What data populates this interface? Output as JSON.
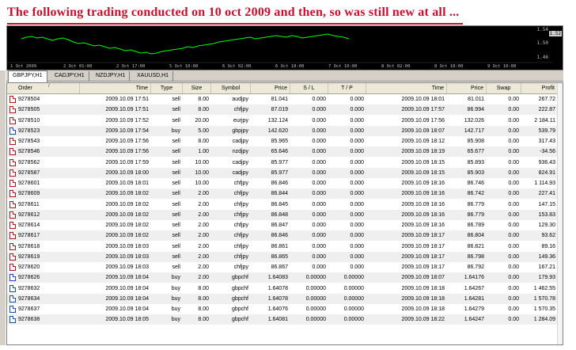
{
  "headline": "The following trading conducted on 10 oct 2009 and then, so was still new at all ...",
  "chart": {
    "price_labels": [
      "1.54",
      "1.50",
      "1.46"
    ],
    "current_price": "1.52",
    "time_labels": [
      "1 Oct 2009",
      "2 Oct 01:00",
      "2 Oct 17:00",
      "5 Oct 10:00",
      "6 Oct 02:00",
      "6 Oct 18:00",
      "7 Oct 10:00",
      "8 Oct 02:00",
      "8 Oct 18:00",
      "9 Oct 10:00"
    ],
    "line_color": "#00ff00"
  },
  "tabs": [
    "GBPJPY,H1",
    "CADJPY,H1",
    "NZDJPY,H1",
    "XAUUSD,H1"
  ],
  "columns": [
    "Order",
    "Time",
    "Type",
    "Size",
    "Symbol",
    "Price",
    "S / L",
    "T / P",
    "Time",
    "Price",
    "Swap",
    "Profit"
  ],
  "sort_indicator": "/",
  "rows": [
    {
      "order": "9278504",
      "open_time": "2009.10.09 17:51",
      "type": "sell",
      "size": "8.00",
      "symbol": "audjpy",
      "price": "81.041",
      "sl": "0.000",
      "tp": "0.000",
      "close_time": "2009.10.09 18:01",
      "close_price": "81.011",
      "swap": "0.00",
      "profit": "267.72"
    },
    {
      "order": "9278505",
      "open_time": "2009.10.09 17:51",
      "type": "sell",
      "size": "8.00",
      "symbol": "chfjpy",
      "price": "87.019",
      "sl": "0.000",
      "tp": "0.000",
      "close_time": "2009.10.09 17:57",
      "close_price": "86.994",
      "swap": "0.00",
      "profit": "222.87"
    },
    {
      "order": "9278510",
      "open_time": "2009.10.09 17:52",
      "type": "sell",
      "size": "20.00",
      "symbol": "eurjpy",
      "price": "132.124",
      "sl": "0.000",
      "tp": "0.000",
      "close_time": "2009.10.09 17:56",
      "close_price": "132.026",
      "swap": "0.00",
      "profit": "2 184.11"
    },
    {
      "order": "9278523",
      "open_time": "2009.10.09 17:54",
      "type": "buy",
      "size": "5.00",
      "symbol": "gbpjpy",
      "price": "142.620",
      "sl": "0.000",
      "tp": "0.000",
      "close_time": "2009.10.09 18:07",
      "close_price": "142.717",
      "swap": "0.00",
      "profit": "539.79"
    },
    {
      "order": "9278543",
      "open_time": "2009.10.09 17:56",
      "type": "sell",
      "size": "8.00",
      "symbol": "cadjpy",
      "price": "85.965",
      "sl": "0.000",
      "tp": "0.000",
      "close_time": "2009.10.09 18:12",
      "close_price": "85.908",
      "swap": "0.00",
      "profit": "317.43"
    },
    {
      "order": "9278546",
      "open_time": "2009.10.09 17:56",
      "type": "sell",
      "size": "1.00",
      "symbol": "nzdjpy",
      "price": "65.646",
      "sl": "0.000",
      "tp": "0.000",
      "close_time": "2009.10.09 18:19",
      "close_price": "65.677",
      "swap": "0.00",
      "profit": "-34.56"
    },
    {
      "order": "9278562",
      "open_time": "2009.10.09 17:59",
      "type": "sell",
      "size": "10.00",
      "symbol": "cadjpy",
      "price": "85.977",
      "sl": "0.000",
      "tp": "0.000",
      "close_time": "2009.10.09 18:15",
      "close_price": "85.893",
      "swap": "0.00",
      "profit": "936.43"
    },
    {
      "order": "9278587",
      "open_time": "2009.10.09 18:00",
      "type": "sell",
      "size": "10.00",
      "symbol": "cadjpy",
      "price": "85.977",
      "sl": "0.000",
      "tp": "0.000",
      "close_time": "2009.10.09 18:15",
      "close_price": "85.903",
      "swap": "0.00",
      "profit": "824.91"
    },
    {
      "order": "9278601",
      "open_time": "2009.10.09 18:01",
      "type": "sell",
      "size": "10.00",
      "symbol": "chfjpy",
      "price": "86.846",
      "sl": "0.000",
      "tp": "0.000",
      "close_time": "2009.10.09 18:16",
      "close_price": "86.746",
      "swap": "0.00",
      "profit": "1 114.93"
    },
    {
      "order": "9278609",
      "open_time": "2009.10.09 18:02",
      "type": "sell",
      "size": "2.00",
      "symbol": "chfjpy",
      "price": "86.844",
      "sl": "0.000",
      "tp": "0.000",
      "close_time": "2009.10.09 18:16",
      "close_price": "86.742",
      "swap": "0.00",
      "profit": "227.41"
    },
    {
      "order": "9278611",
      "open_time": "2009.10.09 18:02",
      "type": "sell",
      "size": "2.00",
      "symbol": "chfjpy",
      "price": "86.845",
      "sl": "0.000",
      "tp": "0.000",
      "close_time": "2009.10.09 18:16",
      "close_price": "86.779",
      "swap": "0.00",
      "profit": "147.15"
    },
    {
      "order": "9278612",
      "open_time": "2009.10.09 18:02",
      "type": "sell",
      "size": "2.00",
      "symbol": "chfjpy",
      "price": "86.848",
      "sl": "0.000",
      "tp": "0.000",
      "close_time": "2009.10.09 18:16",
      "close_price": "86.779",
      "swap": "0.00",
      "profit": "153.83"
    },
    {
      "order": "9278614",
      "open_time": "2009.10.09 18:02",
      "type": "sell",
      "size": "2.00",
      "symbol": "chfjpy",
      "price": "86.847",
      "sl": "0.000",
      "tp": "0.000",
      "close_time": "2009.10.09 18:16",
      "close_price": "86.789",
      "swap": "0.00",
      "profit": "129.30"
    },
    {
      "order": "9278617",
      "open_time": "2009.10.09 18:02",
      "type": "sell",
      "size": "2.00",
      "symbol": "chfjpy",
      "price": "86.846",
      "sl": "0.000",
      "tp": "0.000",
      "close_time": "2009.10.09 18:17",
      "close_price": "86.804",
      "swap": "0.00",
      "profit": "93.62"
    },
    {
      "order": "9278618",
      "open_time": "2009.10.09 18:03",
      "type": "sell",
      "size": "2.00",
      "symbol": "chfjpy",
      "price": "86.861",
      "sl": "0.000",
      "tp": "0.000",
      "close_time": "2009.10.09 18:17",
      "close_price": "86.821",
      "swap": "0.00",
      "profit": "89.16"
    },
    {
      "order": "9278619",
      "open_time": "2009.10.09 18:03",
      "type": "sell",
      "size": "2.00",
      "symbol": "chfjpy",
      "price": "86.865",
      "sl": "0.000",
      "tp": "0.000",
      "close_time": "2009.10.09 18:17",
      "close_price": "86.798",
      "swap": "0.00",
      "profit": "149.36"
    },
    {
      "order": "9278620",
      "open_time": "2009.10.09 18:03",
      "type": "sell",
      "size": "2.00",
      "symbol": "chfjpy",
      "price": "86.867",
      "sl": "0.000",
      "tp": "0.000",
      "close_time": "2009.10.09 18:17",
      "close_price": "86.792",
      "swap": "0.00",
      "profit": "167.21"
    },
    {
      "order": "9278626",
      "open_time": "2009.10.09 18:04",
      "type": "buy",
      "size": "2.00",
      "symbol": "gbpchf",
      "price": "1.64083",
      "sl": "0.00000",
      "tp": "0.00000",
      "close_time": "2009.10.09 18:07",
      "close_price": "1.64176",
      "swap": "0.00",
      "profit": "179.93"
    },
    {
      "order": "9278632",
      "open_time": "2009.10.09 18:04",
      "type": "buy",
      "size": "8.00",
      "symbol": "gbpchf",
      "price": "1.64078",
      "sl": "0.00000",
      "tp": "0.00000",
      "close_time": "2009.10.09 18:18",
      "close_price": "1.64267",
      "swap": "0.00",
      "profit": "1 462.55"
    },
    {
      "order": "9278634",
      "open_time": "2009.10.09 18:04",
      "type": "buy",
      "size": "8.00",
      "symbol": "gbpchf",
      "price": "1.64078",
      "sl": "0.00000",
      "tp": "0.00000",
      "close_time": "2009.10.09 18:18",
      "close_price": "1.64281",
      "swap": "0.00",
      "profit": "1 570.78"
    },
    {
      "order": "9278637",
      "open_time": "2009.10.09 18:04",
      "type": "buy",
      "size": "8.00",
      "symbol": "gbpchf",
      "price": "1.64076",
      "sl": "0.00000",
      "tp": "0.00000",
      "close_time": "2009.10.09 18:18",
      "close_price": "1.64279",
      "swap": "0.00",
      "profit": "1 570.35"
    },
    {
      "order": "9278638",
      "open_time": "2009.10.09 18:05",
      "type": "buy",
      "size": "8.00",
      "symbol": "gbpchf",
      "price": "1.64081",
      "sl": "0.00000",
      "tp": "0.00000",
      "close_time": "2009.10.09 18:22",
      "close_price": "1.64247",
      "swap": "0.00",
      "profit": "1 284.09"
    }
  ]
}
